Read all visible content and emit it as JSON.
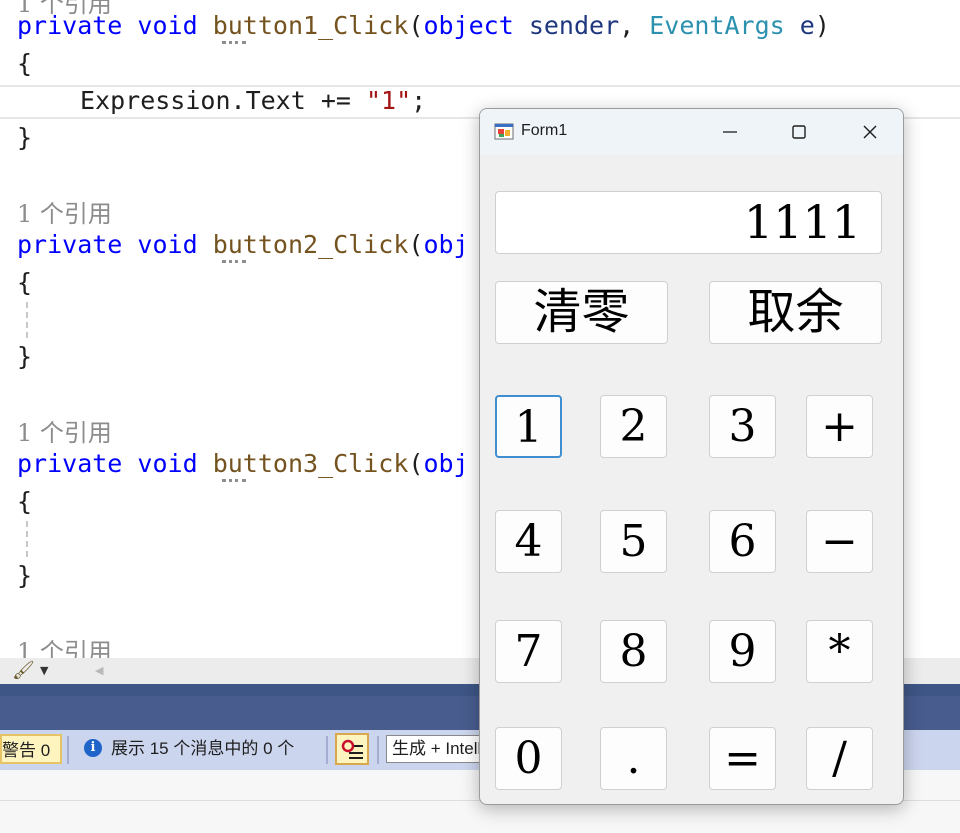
{
  "editor": {
    "line1": {
      "kw1": "private",
      "kw2": "void",
      "fn": "button1_Click",
      "p1": "(",
      "kw3": "object",
      "id1": "sender",
      "p2": ",",
      "ty": "EventArgs",
      "id2": "e",
      "p3": ")"
    },
    "brace_open": "{",
    "brace_close": "}",
    "body_line": {
      "a": "Expression.Text += ",
      "str": "\"1\"",
      "b": ";"
    },
    "ref_label": "1 个引用",
    "line2": {
      "kw1": "private",
      "kw2": "void",
      "fn": "button2_Click",
      "p1": "(",
      "kw3": "obj"
    },
    "line3": {
      "kw1": "private",
      "kw2": "void",
      "fn": "button3_Click",
      "p1": "(",
      "kw3": "obj"
    }
  },
  "error_list": {
    "warnings_label": "警告 0",
    "messages_label": "展示 15 个消息中的 0 个",
    "build_filter": "生成 + IntelliSense"
  },
  "form": {
    "title": "Form1",
    "display_value": "1111",
    "clear_label": "清零",
    "mod_label": "取余",
    "keys": [
      "1",
      "2",
      "3",
      "+",
      "4",
      "5",
      "6",
      "−",
      "7",
      "8",
      "9",
      "*",
      "0",
      ".",
      "=",
      "/"
    ]
  },
  "colors": {
    "keyword": "#0000ff",
    "method": "#74531f",
    "type": "#2b91af",
    "string": "#a31515",
    "focus_border": "#3f8fd0"
  }
}
